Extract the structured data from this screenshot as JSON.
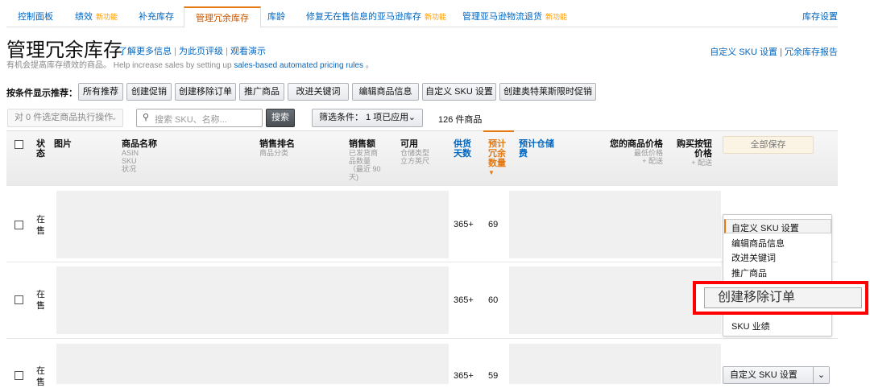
{
  "tabs": [
    {
      "label": "控制面板"
    },
    {
      "label": "绩效",
      "badge": "新功能"
    },
    {
      "label": "补充库存"
    },
    {
      "label": "管理冗余库存"
    },
    {
      "label": "库龄"
    },
    {
      "label": "修复无在售信息的亚马逊库存",
      "badge": "新功能"
    },
    {
      "label": "管理亚马逊物流退货",
      "badge": "新功能"
    }
  ],
  "inventory_settings": "库存设置",
  "page": {
    "title": "管理冗余库存",
    "learn_more": "了解更多信息",
    "rate_page": "为此页评级",
    "watch_demo": "观看演示",
    "subtitle": "有机会提高库存绩效的商品。 Help increase sales by setting up",
    "subtitle_link": "sales-based automated pricing rules",
    "subtitle_end": "。",
    "custom_sku": "自定义 SKU 设置",
    "excess_report": "冗余库存报告"
  },
  "recommend": {
    "label": "按条件显示推荐：",
    "buttons": [
      "所有推荐",
      "创建促销",
      "创建移除订单",
      "推广商品",
      "改进关键词",
      "编辑商品信息",
      "自定义 SKU 设置",
      "创建奥特莱斯限时促销"
    ]
  },
  "toolbar": {
    "bulk_action": "对 0 件选定商品执行操作",
    "search_placeholder": "搜索 SKU、名称...",
    "search_button": "搜索",
    "filter": "筛选条件： 1 项已应用",
    "count": "126 件商品"
  },
  "headers": {
    "status": "状态",
    "image": "图片",
    "name": "商品名称",
    "name_sub": [
      "ASIN",
      "SKU",
      "状况"
    ],
    "rank": "销售排名",
    "rank_sub": "商品分类",
    "sales": "销售额",
    "sales_sub": "已发货商品数量 （最近 90 天)",
    "available": "可用",
    "available_sub": "仓储类型 立方英尺",
    "days": "供货天数",
    "excess": "预计冗余数量",
    "fee": "预计仓储费",
    "price": "您的商品价格",
    "price_sub": [
      "最低价格",
      "+ 配送"
    ],
    "buybox": "购买按钮价格",
    "buybox_sub": "+ 配送",
    "save_all": "全部保存"
  },
  "rows": [
    {
      "status": "在售",
      "days": "365+",
      "excess": "69"
    },
    {
      "status": "在售",
      "days": "365+",
      "excess": "60"
    },
    {
      "status": "在售",
      "days": "365+",
      "excess": "59"
    }
  ],
  "menu": {
    "items": [
      "自定义 SKU 设置",
      "编辑商品信息",
      "改进关键词",
      "推广商品",
      "创建移除订单",
      "SKU 业绩"
    ]
  },
  "row3_action": "自定义 SKU 设置",
  "colors": {
    "accent": "#e47911",
    "link": "#0066c0",
    "highlight": "#ff0000"
  }
}
